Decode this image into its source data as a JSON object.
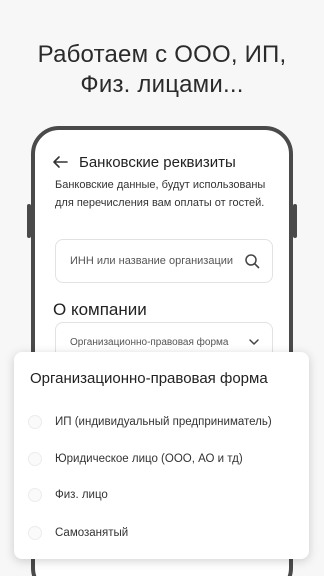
{
  "promo": {
    "title_line1": "Работаем с ООО, ИП,",
    "title_line2": "Физ. лицами..."
  },
  "screen": {
    "title": "Банковские реквизиты",
    "description": "Банковские данные, будут использованы для перечисления вам оплаты от гостей.",
    "search": {
      "placeholder": "ИНН или название организации"
    },
    "section_title": "О компании",
    "legal_form": {
      "label": "Организационно-правовая форма"
    }
  },
  "sheet": {
    "title": "Организационно-правовая форма",
    "options": [
      {
        "label": "ИП (индивидуальный предприниматель)",
        "selected": false
      },
      {
        "label": "Юридическое лицо (ООО, АО и тд)",
        "selected": false
      },
      {
        "label": "Физ. лицо",
        "selected": false
      },
      {
        "label": "Самозанятый",
        "selected": false
      }
    ]
  },
  "icons": {
    "back": "arrow-left-icon",
    "search": "search-icon",
    "dropdown": "chevron-down-icon"
  },
  "colors": {
    "background": "#f7f7f7",
    "phone_frame": "#4a4a4a",
    "text": "#222222"
  }
}
